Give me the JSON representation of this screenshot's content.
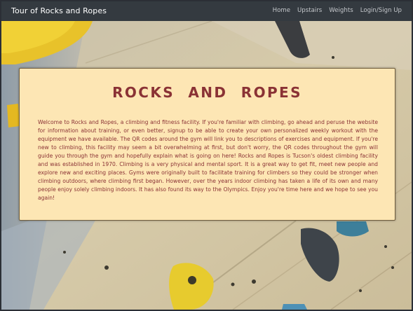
{
  "navbar": {
    "brand": "Tour of Rocks and Ropes",
    "links": [
      "Home",
      "Upstairs",
      "Weights",
      "Login/Sign Up"
    ]
  },
  "hero": {
    "title": "ROCKS AND ROPES",
    "description": "Welcome to Rocks and Ropes, a climbing and fitness facility. If you're familiar with climbing, go ahead and peruse the website for information about training, or even better, signup to be able to create your own personalized weekly workout with the equipment we have available. The QR codes around the gym will link you to descriptions of exercises and equipment. If you're new to climbing, this facility may seem a bit overwhelming at first, but don't worry, the QR codes throughout the gym will guide you through the gym and hopefully explain what is going on here! Rocks and Ropes is Tucson's oldest climbing facility and was established in 1970. Climbing is a very physical and mental sport. It is a great way to get fit, meet new people and explore new and exciting places. Gyms were originally built to facilitate training for climbers so they could be stronger when climbing outdoors, where climbing first began. However, over the years indoor climbing has taken a life of its own and many people enjoy solely climbing indoors. It has also found its way to the Olympics. Enjoy you're time here and we hope to see you again!"
  },
  "colors": {
    "navbar_bg": "#343a40",
    "card_bg": "#fde6b4",
    "accent_text": "#8a3235",
    "nav_link": "#c4c7cb"
  }
}
